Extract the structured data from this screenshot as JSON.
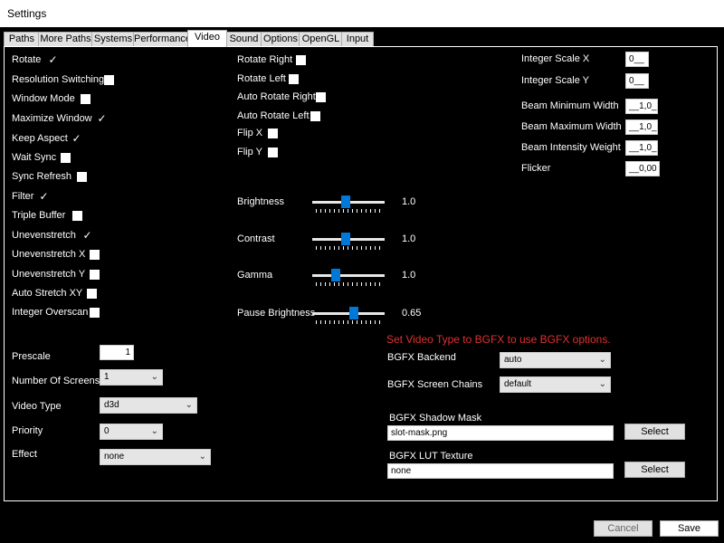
{
  "window": {
    "title": "Settings"
  },
  "tabs": [
    "Paths",
    "More Paths",
    "Systems",
    "Performance",
    "Video",
    "Sound",
    "Options",
    "OpenGL",
    "Input"
  ],
  "active_tab": "Video",
  "col1_checks": [
    {
      "label": "Rotate",
      "checked": true
    },
    {
      "label": "Resolution Switching",
      "checked": false
    },
    {
      "label": "Window Mode",
      "checked": false
    },
    {
      "label": "Maximize Window",
      "checked": true
    },
    {
      "label": "Keep Aspect",
      "checked": true
    },
    {
      "label": "Wait Sync",
      "checked": false
    },
    {
      "label": "Sync Refresh",
      "checked": false
    },
    {
      "label": "Filter",
      "checked": true
    },
    {
      "label": "Triple Buffer",
      "checked": false
    },
    {
      "label": "Unevenstretch",
      "checked": true
    },
    {
      "label": "Unevenstretch  X",
      "checked": false
    },
    {
      "label": "Unevenstretch  Y",
      "checked": false
    },
    {
      "label": "Auto Stretch XY",
      "checked": false
    },
    {
      "label": "Integer Overscan",
      "checked": false
    }
  ],
  "col2_checks": [
    {
      "label": "Rotate Right",
      "checked": false
    },
    {
      "label": "Rotate Left",
      "checked": false
    },
    {
      "label": "Auto Rotate Right",
      "checked": false
    },
    {
      "label": "Auto Rotate Left",
      "checked": false
    },
    {
      "label": "Flip X",
      "checked": false
    },
    {
      "label": "Flip Y",
      "checked": false
    }
  ],
  "right_fields": [
    {
      "label": "Integer Scale X",
      "value": "0__"
    },
    {
      "label": "Integer Scale Y",
      "value": "0__"
    },
    {
      "label": "Beam Minimum Width",
      "value": "__1,0_"
    },
    {
      "label": "Beam Maximum Width",
      "value": "__1,0_"
    },
    {
      "label": "Beam Intensity Weight",
      "value": "__1,0_"
    },
    {
      "label": "Flicker",
      "value": "__0,00"
    }
  ],
  "sliders": [
    {
      "label": "Brightness",
      "value": "1.0",
      "position": 0.45
    },
    {
      "label": "Contrast",
      "value": "1.0",
      "position": 0.45
    },
    {
      "label": " Gamma",
      "value": "1.0",
      "position": 0.3
    },
    {
      "label": "Pause Brightness",
      "value": "0.65",
      "position": 0.58
    }
  ],
  "bottom_left": {
    "prescale": {
      "label": "Prescale",
      "value": "1"
    },
    "screens": {
      "label": "Number Of Screens",
      "value": "1"
    },
    "video_type": {
      "label": "Video Type",
      "value": "d3d"
    },
    "priority": {
      "label": "Priority",
      "value": "0"
    },
    "effect": {
      "label": "Effect",
      "value": "none"
    }
  },
  "bgfx": {
    "warning": "Set Video Type to BGFX to use BGFX options.",
    "backend": {
      "label": "BGFX Backend",
      "value": "auto"
    },
    "chains": {
      "label": "BGFX Screen Chains",
      "value": "default"
    },
    "shadow_mask": {
      "label": "BGFX Shadow Mask",
      "value": "slot-mask.png",
      "button": "Select"
    },
    "lut": {
      "label": "BGFX LUT Texture",
      "value": "none",
      "button": "Select"
    }
  },
  "footer": {
    "cancel": "Cancel",
    "save": "Save"
  }
}
